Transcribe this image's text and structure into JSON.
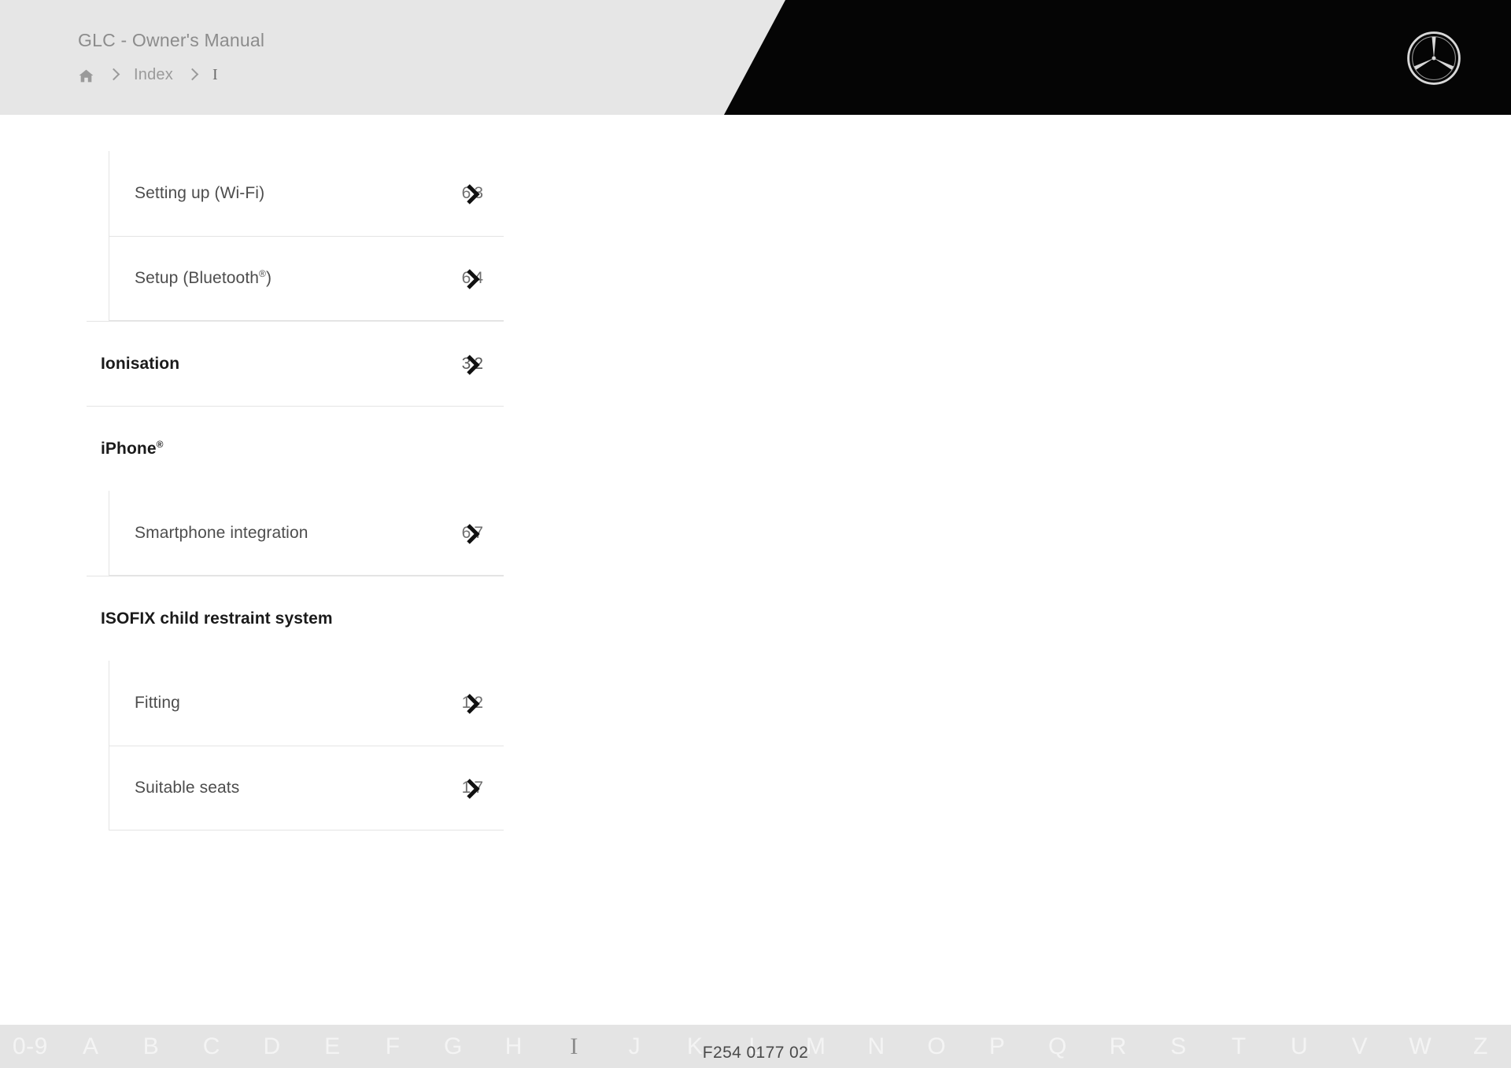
{
  "header": {
    "title": "GLC - Owner's Manual",
    "breadcrumb": {
      "home_icon": "home-icon",
      "separator_icon": "chevron-right-icon",
      "items": [
        {
          "label": "Index",
          "current": false
        },
        {
          "label": "I",
          "current": true
        }
      ]
    },
    "logo": "mercedes-benz-star-icon",
    "background_color": "#e6e6e6",
    "banner_color": "#050505"
  },
  "index": {
    "entries": [
      {
        "label": "Setting up (Wi-Fi)",
        "level": 1,
        "page": "63",
        "link_icon": "chevron-right-icon",
        "first_sub": true,
        "last_sub": false
      },
      {
        "label": "Setup (Bluetooth",
        "suffix": "®",
        "label_tail": ")",
        "level": 1,
        "page": "64",
        "link_icon": "chevron-right-icon",
        "first_sub": false,
        "last_sub": true
      },
      {
        "label": "Ionisation",
        "level": 0,
        "page": "32",
        "link_icon": "chevron-right-icon"
      },
      {
        "label": "iPhone",
        "suffix": "®",
        "level": 0,
        "page": "",
        "link_icon": ""
      },
      {
        "label": "Smartphone integration",
        "level": 1,
        "page": "67",
        "link_icon": "chevron-right-icon",
        "first_sub": true,
        "last_sub": true
      },
      {
        "label": "ISOFIX child restraint system",
        "level": 0,
        "page": "",
        "link_icon": ""
      },
      {
        "label": "Fitting",
        "level": 1,
        "page": "12",
        "link_icon": "chevron-right-icon",
        "first_sub": true,
        "last_sub": false
      },
      {
        "label": "Suitable seats",
        "level": 1,
        "page": "17",
        "link_icon": "chevron-right-icon",
        "first_sub": false,
        "last_sub": true
      }
    ]
  },
  "alphabet_bar": {
    "active_letter": "I",
    "letters": [
      "0-9",
      "A",
      "B",
      "C",
      "D",
      "E",
      "F",
      "G",
      "H",
      "I",
      "J",
      "K",
      "L",
      "M",
      "N",
      "O",
      "P",
      "Q",
      "R",
      "S",
      "T",
      "U",
      "V",
      "W",
      "Z"
    ],
    "background_color": "#e4e4e4",
    "letter_color": "#f4f4f4",
    "active_color": "#8c8c8c"
  },
  "footer": {
    "document_code": "F254 0177 02"
  }
}
